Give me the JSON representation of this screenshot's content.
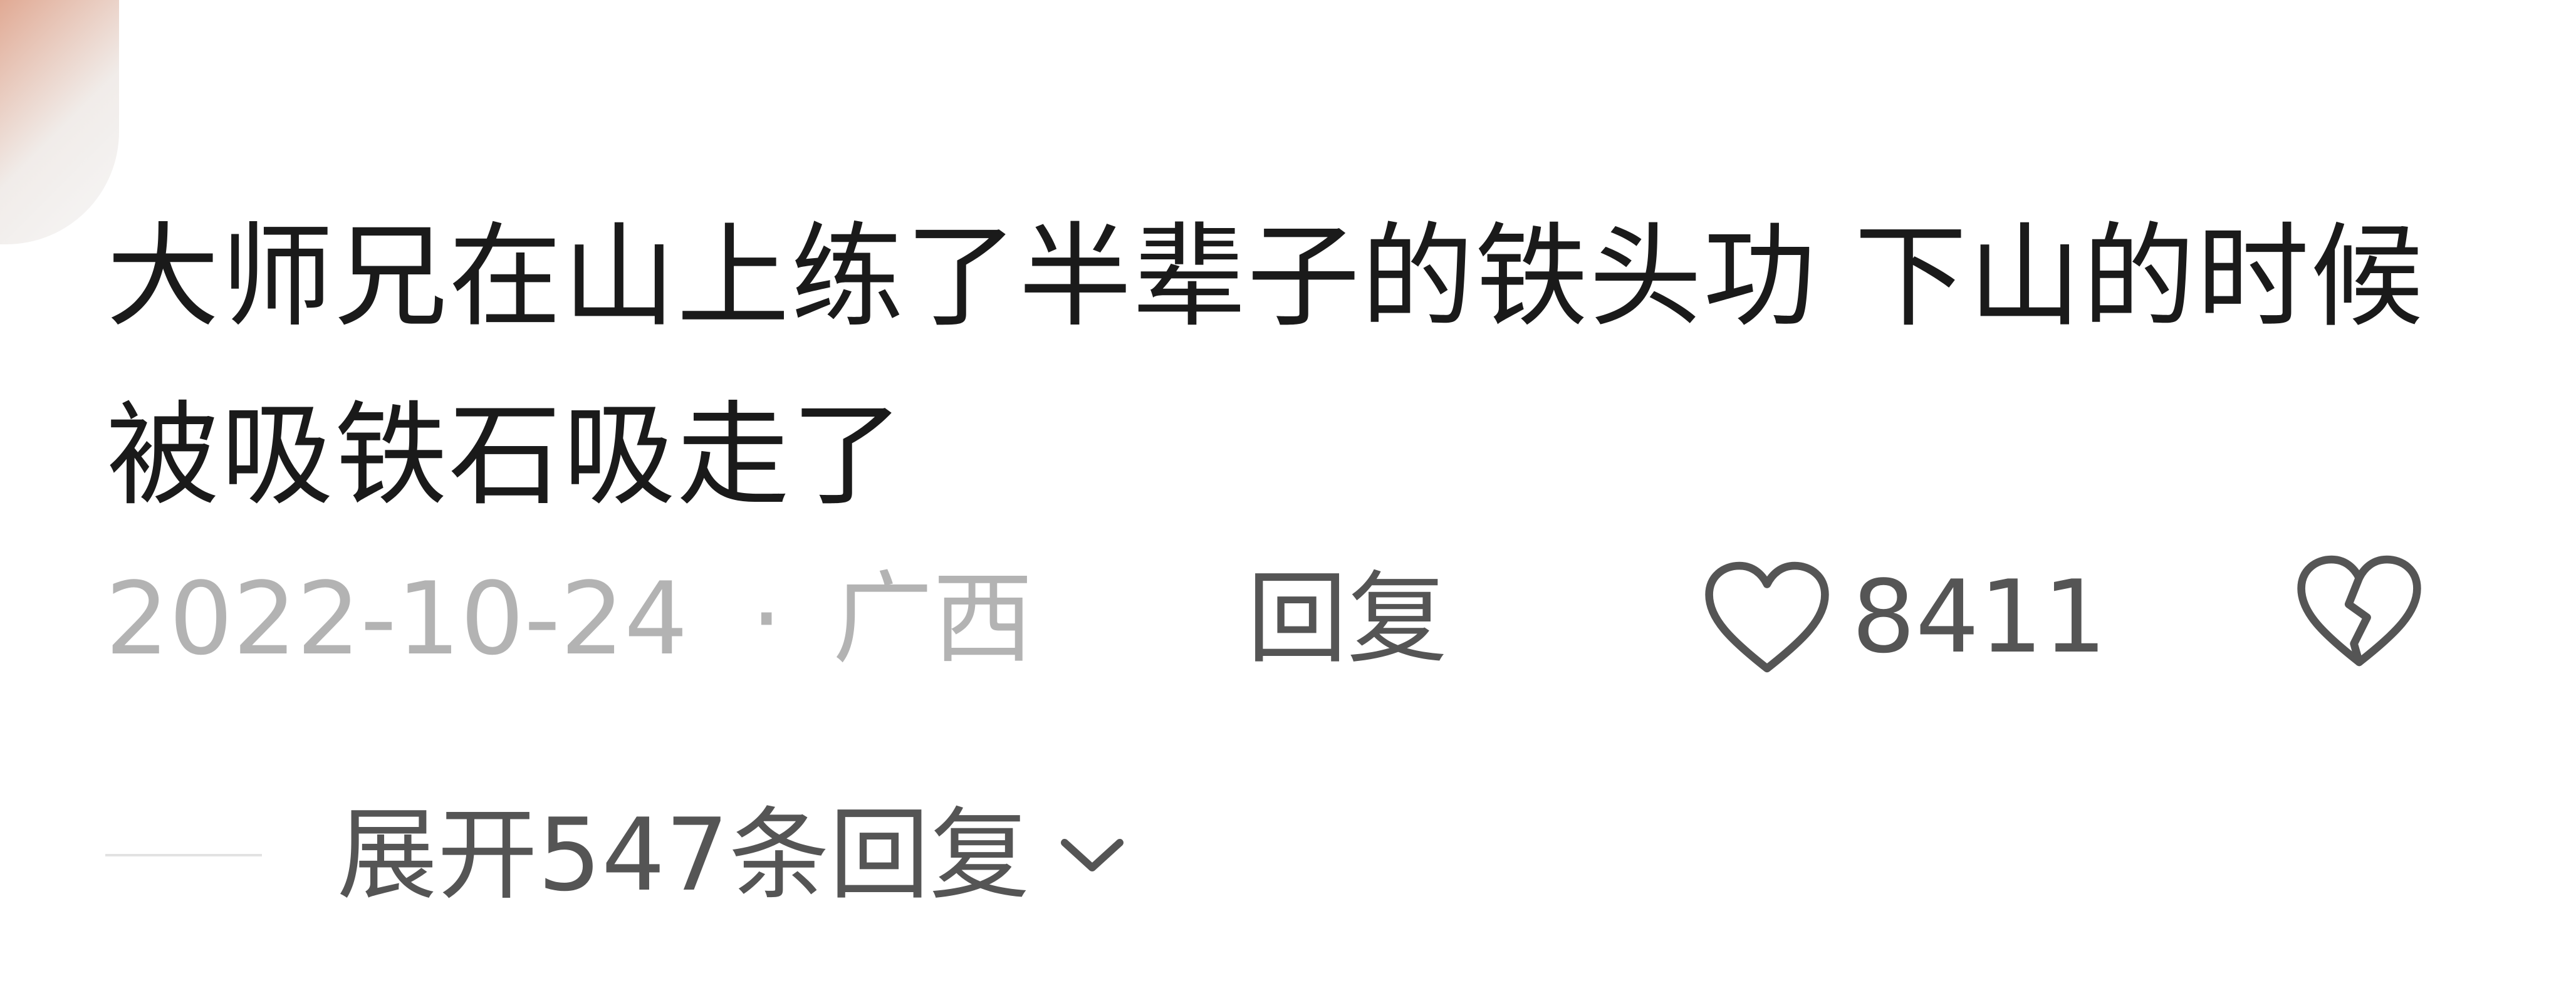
{
  "comment": {
    "text": "大师兄在山上练了半辈子的铁头功 下山的时候被吸铁石吸走了",
    "date": "2022-10-24",
    "separator": "·",
    "location": "广西",
    "reply_label": "回复",
    "like_count": "8411"
  },
  "replies": {
    "expand_label": "展开547条回复"
  },
  "icons": {
    "like": "heart-outline-icon",
    "dislike": "broken-heart-icon",
    "expand": "chevron-down-icon"
  },
  "colors": {
    "text_primary": "#1a1a1a",
    "text_secondary": "#555555",
    "text_muted": "#b3b3b3"
  }
}
